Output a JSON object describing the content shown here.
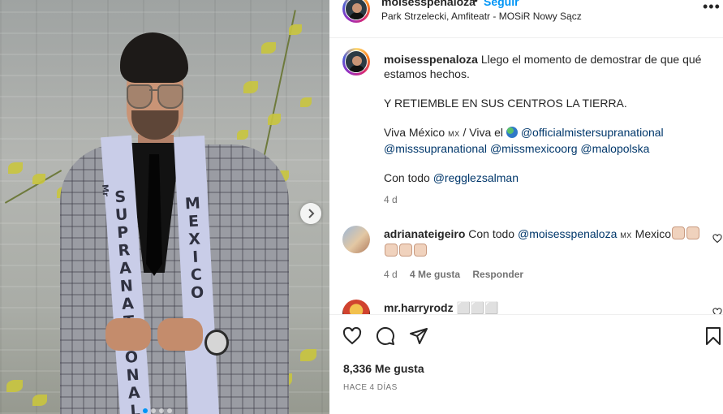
{
  "post": {
    "username": "moisesspenaloza",
    "follow_label": "Seguir",
    "separator": "•",
    "location": "Park Strzelecki, Amfiteatr - MOSiR Nowy Sącz",
    "more_label": "•••",
    "image": {
      "sash_left_text": "SUPRANATIONAL",
      "sash_left_prefix": "Mr",
      "sash_right_text": "MEXICO",
      "current_slide": 1,
      "slide_count": 4
    }
  },
  "caption": {
    "username": "moisesspenaloza",
    "line1": "Llego el momento de demostrar de que qué estamos hechos.",
    "line2": "Y RETIEMBLE EN SUS CENTROS LA TIERRA.",
    "line3_prefix": "Viva México",
    "line3_flag": "MX",
    "line3_middle": "/ Viva el",
    "mention1": "@officialmistersupranational",
    "mention2": "@misssupranational",
    "mention3": "@missmexicoorg",
    "mention4": "@malopolska",
    "line4_prefix": "Con todo",
    "mention5": "@regglezsalman",
    "time": "4 d"
  },
  "comments": [
    {
      "username": "adrianateigeiro",
      "text_prefix": "Con todo",
      "mention": "@moisesspenaloza",
      "flag": "MX",
      "text_suffix": "Mexico",
      "time": "4 d",
      "likes": "4 Me gusta",
      "reply": "Responder"
    },
    {
      "username": "mr.harryrodz",
      "text": "⬜⬜⬜"
    }
  ],
  "footer": {
    "likes": "8,336 Me gusta",
    "time": "HACE 4 DÍAS"
  }
}
